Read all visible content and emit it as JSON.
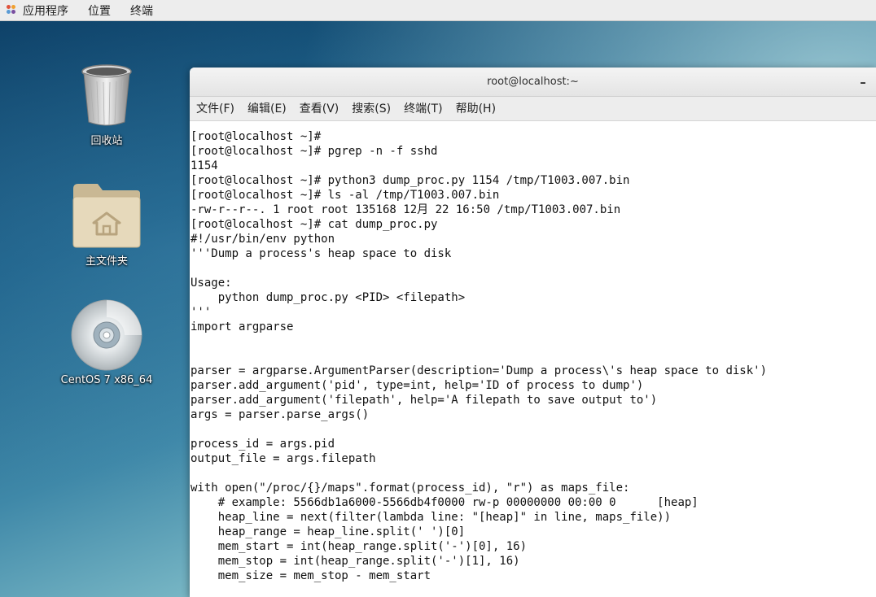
{
  "top_panel": {
    "apps_label": "应用程序",
    "places_label": "位置",
    "terminal_label": "终端"
  },
  "desktop": {
    "trash_label": "回收站",
    "home_label": "主文件夹",
    "dvd_label": "CentOS 7 x86_64"
  },
  "window": {
    "title": "root@localhost:~",
    "minimize_symbol": "–",
    "menu": [
      "文件(F)",
      "编辑(E)",
      "查看(V)",
      "搜索(S)",
      "终端(T)",
      "帮助(H)"
    ]
  },
  "terminal": {
    "lines": [
      "[root@localhost ~]#",
      "[root@localhost ~]# pgrep -n -f sshd",
      "1154",
      "[root@localhost ~]# python3 dump_proc.py 1154 /tmp/T1003.007.bin",
      "[root@localhost ~]# ls -al /tmp/T1003.007.bin",
      "-rw-r--r--. 1 root root 135168 12月 22 16:50 /tmp/T1003.007.bin",
      "[root@localhost ~]# cat dump_proc.py",
      "#!/usr/bin/env python",
      "'''Dump a process's heap space to disk",
      "",
      "Usage:",
      "    python dump_proc.py <PID> <filepath>",
      "'''",
      "import argparse",
      "",
      "",
      "parser = argparse.ArgumentParser(description='Dump a process\\'s heap space to disk')",
      "parser.add_argument('pid', type=int, help='ID of process to dump')",
      "parser.add_argument('filepath', help='A filepath to save output to')",
      "args = parser.parse_args()",
      "",
      "process_id = args.pid",
      "output_file = args.filepath",
      "",
      "with open(\"/proc/{}/maps\".format(process_id), \"r\") as maps_file:",
      "    # example: 5566db1a6000-5566db4f0000 rw-p 00000000 00:00 0      [heap]",
      "    heap_line = next(filter(lambda line: \"[heap]\" in line, maps_file))",
      "    heap_range = heap_line.split(' ')[0]",
      "    mem_start = int(heap_range.split('-')[0], 16)",
      "    mem_stop = int(heap_range.split('-')[1], 16)",
      "    mem_size = mem_stop - mem_start"
    ]
  }
}
